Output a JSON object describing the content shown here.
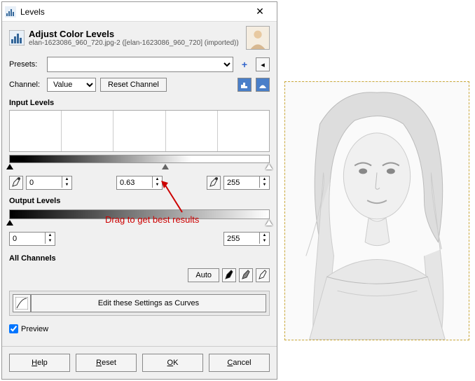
{
  "window": {
    "title": "Levels",
    "close": "✕"
  },
  "header": {
    "title": "Adjust Color Levels",
    "filename": "elan-1623086_960_720.jpg-2 ([elan-1623086_960_720] (imported))"
  },
  "presets": {
    "label": "Presets:",
    "value": "",
    "add": "+"
  },
  "channel": {
    "label": "Channel:",
    "value": "Value",
    "reset": "Reset Channel"
  },
  "input_levels": {
    "label": "Input Levels",
    "low": "0",
    "gamma": "0.63",
    "high": "255"
  },
  "output_levels": {
    "label": "Output Levels",
    "low": "0",
    "high": "255"
  },
  "all_channels": {
    "label": "All Channels",
    "auto": "Auto"
  },
  "curves": {
    "button": "Edit these Settings as Curves"
  },
  "preview": {
    "label": "Preview",
    "checked": true
  },
  "footer": {
    "help": "Help",
    "reset": "Reset",
    "ok": "OK",
    "cancel": "Cancel"
  },
  "annotation": {
    "text": "Drag to get best results"
  }
}
